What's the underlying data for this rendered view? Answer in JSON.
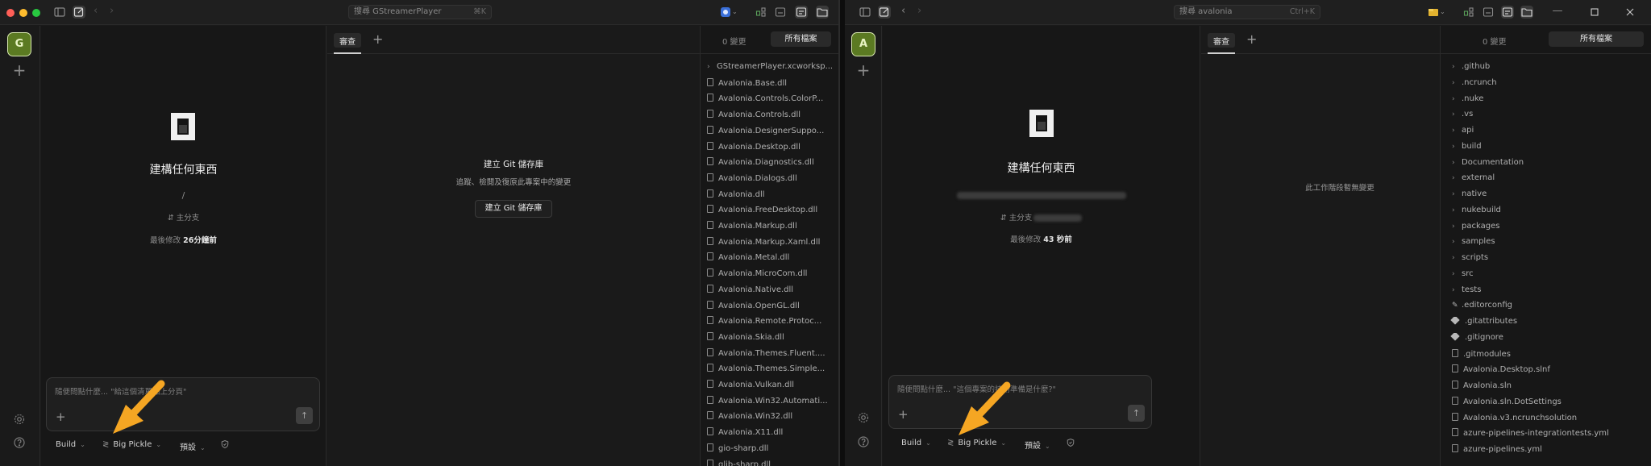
{
  "left": {
    "search_text": "搜尋 GStreamerPlayer",
    "search_shortcut": "⌘K",
    "avatar_letter": "G",
    "headline": "建構任何東西",
    "path": "/",
    "branch_label": "主分支",
    "last_modified_label": "最後修改",
    "last_modified_value": "26分鐘前",
    "prompt_placeholder": "隨便問點什麼... \"給這個清單加上分頁\"",
    "toolbar": {
      "agent": "Build",
      "model": "Big Pickle",
      "preset": "預設"
    },
    "tab_review": "審查",
    "git_title": "建立 Git 儲存庫",
    "git_subtitle": "追蹤、檢閱及復原此專案中的變更",
    "git_button": "建立 Git 儲存庫",
    "changes": "0 變更",
    "all_files": "所有檔案",
    "files": [
      {
        "name": "GStreamerPlayer.xcworksp...",
        "kind": "folder"
      },
      {
        "name": "Avalonia.Base.dll",
        "kind": "file"
      },
      {
        "name": "Avalonia.Controls.ColorP...",
        "kind": "file"
      },
      {
        "name": "Avalonia.Controls.dll",
        "kind": "file"
      },
      {
        "name": "Avalonia.DesignerSuppo...",
        "kind": "file"
      },
      {
        "name": "Avalonia.Desktop.dll",
        "kind": "file"
      },
      {
        "name": "Avalonia.Diagnostics.dll",
        "kind": "file"
      },
      {
        "name": "Avalonia.Dialogs.dll",
        "kind": "file"
      },
      {
        "name": "Avalonia.dll",
        "kind": "file"
      },
      {
        "name": "Avalonia.FreeDesktop.dll",
        "kind": "file"
      },
      {
        "name": "Avalonia.Markup.dll",
        "kind": "file"
      },
      {
        "name": "Avalonia.Markup.Xaml.dll",
        "kind": "file"
      },
      {
        "name": "Avalonia.Metal.dll",
        "kind": "file"
      },
      {
        "name": "Avalonia.MicroCom.dll",
        "kind": "file"
      },
      {
        "name": "Avalonia.Native.dll",
        "kind": "file"
      },
      {
        "name": "Avalonia.OpenGL.dll",
        "kind": "file"
      },
      {
        "name": "Avalonia.Remote.Protoc...",
        "kind": "file"
      },
      {
        "name": "Avalonia.Skia.dll",
        "kind": "file"
      },
      {
        "name": "Avalonia.Themes.Fluent....",
        "kind": "file"
      },
      {
        "name": "Avalonia.Themes.Simple...",
        "kind": "file"
      },
      {
        "name": "Avalonia.Vulkan.dll",
        "kind": "file"
      },
      {
        "name": "Avalonia.Win32.Automati...",
        "kind": "file"
      },
      {
        "name": "Avalonia.Win32.dll",
        "kind": "file"
      },
      {
        "name": "Avalonia.X11.dll",
        "kind": "file"
      },
      {
        "name": "gio-sharp.dll",
        "kind": "file"
      },
      {
        "name": "glib-sharp.dll",
        "kind": "file"
      }
    ]
  },
  "right": {
    "search_text": "搜尋 avalonia",
    "search_shortcut": "Ctrl+K",
    "avatar_letter": "A",
    "headline": "建構任何東西",
    "branch_label": "主分支",
    "last_modified_label": "最後修改",
    "last_modified_value": "43 秒前",
    "prompt_placeholder": "隨便問點什麼... \"這個專案的技術準備是什麼?\"",
    "toolbar": {
      "agent": "Build",
      "model": "Big Pickle",
      "preset": "預設"
    },
    "tab_review": "審查",
    "no_changes": "此工作階段暫無變更",
    "changes": "0 變更",
    "all_files": "所有檔案",
    "files": [
      {
        "name": ".github",
        "kind": "folder"
      },
      {
        "name": ".ncrunch",
        "kind": "folder"
      },
      {
        "name": ".nuke",
        "kind": "folder"
      },
      {
        "name": ".vs",
        "kind": "folder"
      },
      {
        "name": "api",
        "kind": "folder"
      },
      {
        "name": "build",
        "kind": "folder"
      },
      {
        "name": "Documentation",
        "kind": "folder"
      },
      {
        "name": "external",
        "kind": "folder"
      },
      {
        "name": "native",
        "kind": "folder"
      },
      {
        "name": "nukebuild",
        "kind": "folder"
      },
      {
        "name": "packages",
        "kind": "folder"
      },
      {
        "name": "samples",
        "kind": "folder"
      },
      {
        "name": "scripts",
        "kind": "folder"
      },
      {
        "name": "src",
        "kind": "folder"
      },
      {
        "name": "tests",
        "kind": "folder"
      },
      {
        "name": ".editorconfig",
        "kind": "config"
      },
      {
        "name": ".gitattributes",
        "kind": "git"
      },
      {
        "name": ".gitignore",
        "kind": "git"
      },
      {
        "name": ".gitmodules",
        "kind": "file"
      },
      {
        "name": "Avalonia.Desktop.slnf",
        "kind": "file"
      },
      {
        "name": "Avalonia.sln",
        "kind": "file"
      },
      {
        "name": "Avalonia.sln.DotSettings",
        "kind": "file"
      },
      {
        "name": "Avalonia.v3.ncrunchsolution",
        "kind": "file"
      },
      {
        "name": "azure-pipelines-integrationtests.yml",
        "kind": "file"
      },
      {
        "name": "azure-pipelines.yml",
        "kind": "file"
      }
    ]
  },
  "colors": {
    "bg": "#1a1a1a",
    "avatar_green": "#5b7a22",
    "arrow_orange": "#f5a623",
    "traffic_red": "#ff5f57",
    "traffic_yellow": "#febc2e",
    "traffic_green": "#28c840"
  }
}
